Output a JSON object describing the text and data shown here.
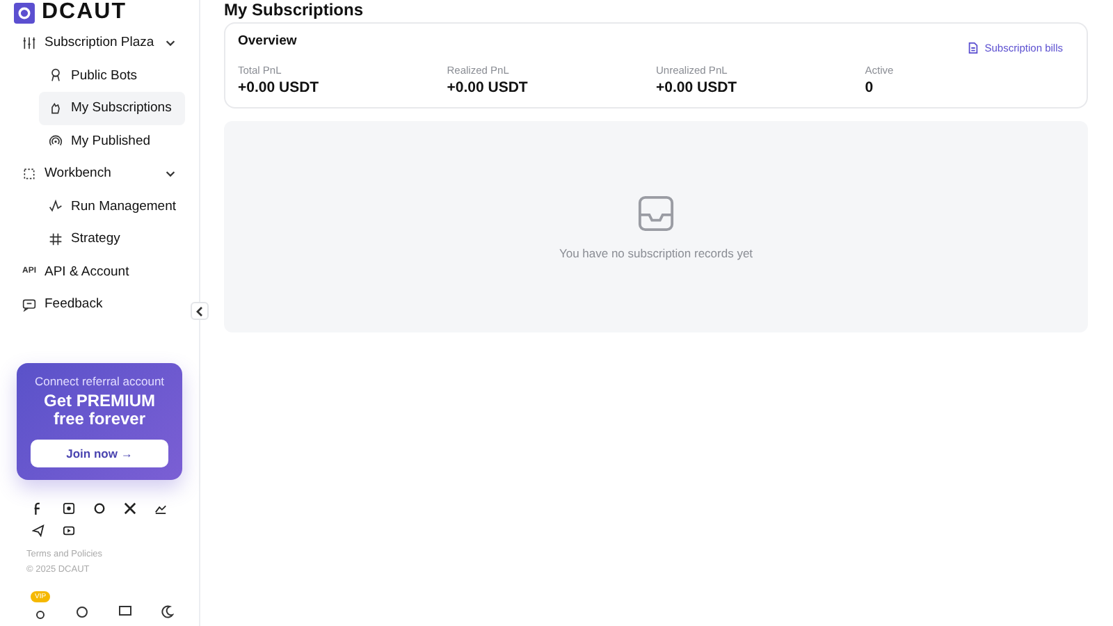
{
  "logo": {
    "text": "DCAUT"
  },
  "sidebar": {
    "items": [
      {
        "kind": "group",
        "label": "Subscription Plaza",
        "expanded": true,
        "children": [
          {
            "label": "Public Bots",
            "selected": false
          },
          {
            "label": "My Subscriptions",
            "selected": true
          },
          {
            "label": "My Published",
            "selected": false
          }
        ]
      },
      {
        "kind": "group",
        "label": "Workbench",
        "expanded": true,
        "children": [
          {
            "label": "Run Management",
            "selected": false
          },
          {
            "label": "Strategy",
            "selected": false
          }
        ]
      },
      {
        "kind": "link",
        "label": "API & Account",
        "icon_text": "API"
      },
      {
        "kind": "link",
        "label": "Feedback"
      }
    ]
  },
  "promo": {
    "subtitle": "Connect referral account",
    "title_line_1": "Get PREMIUM",
    "title_line_2": "free forever",
    "button": "Join now →"
  },
  "footer": {
    "terms": "Terms and Policies",
    "copyright": "© 2025 DCAUT"
  },
  "bottom_bar": {
    "badge": "VIP"
  },
  "page": {
    "title": "My Subscriptions"
  },
  "overview": {
    "title": "Overview",
    "bills_link": "Subscription bills",
    "stats": [
      {
        "label": "Total PnL",
        "value": "+0.00 USDT"
      },
      {
        "label": "Realized PnL",
        "value": "+0.00 USDT"
      },
      {
        "label": "Unrealized PnL",
        "value": "+0.00 USDT"
      },
      {
        "label": "Active",
        "value": "0"
      }
    ]
  },
  "empty_state": {
    "message": "You have no subscription records yet"
  }
}
